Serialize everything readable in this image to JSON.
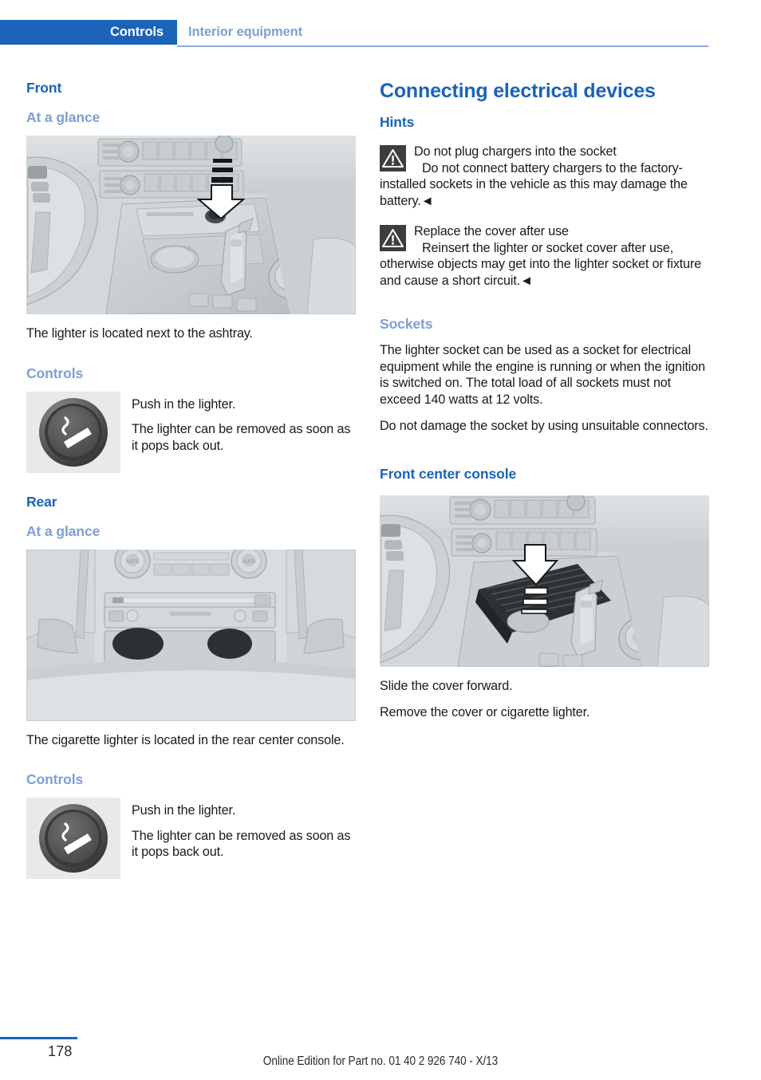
{
  "header": {
    "tab_label": "Controls",
    "section_label": "Interior equipment"
  },
  "left_column": {
    "front_heading": "Front",
    "front_at_a_glance_heading": "At a glance",
    "front_figure_caption": "The lighter is located next to the ashtray.",
    "front_controls_heading": "Controls",
    "front_controls_line1": "Push in the lighter.",
    "front_controls_line2": "The lighter can be removed as soon as it pops back out.",
    "rear_heading": "Rear",
    "rear_at_a_glance_heading": "At a glance",
    "rear_figure_caption": "The cigarette lighter is located in the rear center console.",
    "rear_controls_heading": "Controls",
    "rear_controls_line1": "Push in the lighter.",
    "rear_controls_line2": "The lighter can be removed as soon as it pops back out."
  },
  "right_column": {
    "title": "Connecting electrical devices",
    "hints_heading": "Hints",
    "warning1_title": "Do not plug chargers into the socket",
    "warning1_text": "Do not connect battery chargers to the factory-installed sockets in the vehicle as this may damage the battery.◄",
    "warning2_title": "Replace the cover after use",
    "warning2_text": "Reinsert the lighter or socket cover after use, otherwise objects may get into the lighter socket or fixture and cause a short circuit.◄",
    "sockets_heading": "Sockets",
    "sockets_para1": "The lighter socket can be used as a socket for electrical equipment while the engine is running or when the ignition is switched on. The total load of all sockets must not exceed 140 watts at 12 volts.",
    "sockets_para2": "Do not damage the socket by using unsuitable connectors.",
    "front_center_console_heading": "Front center console",
    "console_line1": "Slide the cover forward.",
    "console_line2": "Remove the cover or cigarette lighter."
  },
  "footer": {
    "page_number": "178",
    "edition": "Online Edition for Part no. 01 40 2 926 740 - X/13"
  },
  "colors": {
    "brand_blue": "#1a63b8",
    "light_blue": "#7e9fd4",
    "rule_blue": "#8fa8d8",
    "warning_icon_bg": "#3d3d3d",
    "icon_panel_bg": "#e9e9e9",
    "body_text": "#1a1a1a"
  },
  "icons": {
    "warning": "warning-triangle-icon",
    "lighter": "cigarette-lighter-icon",
    "arrow_down": "arrow-down-icon",
    "arrow_up": "arrow-up-icon"
  }
}
